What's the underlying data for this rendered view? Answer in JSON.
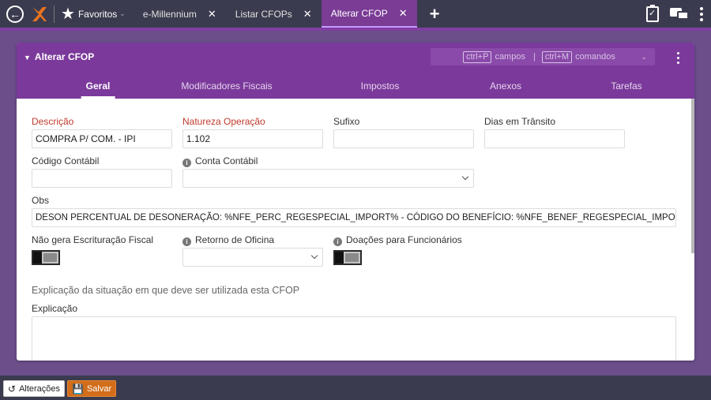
{
  "topbar": {
    "back_icon": "back-arrow-icon",
    "logo_icon": "brand-logo-icon",
    "favorites_label": "Favoritos",
    "tabs": [
      {
        "label": "e-Millennium"
      },
      {
        "label": "Listar CFOPs"
      },
      {
        "label": "Alterar CFOP"
      }
    ],
    "active_tab_color": "#7a3c95"
  },
  "panel": {
    "title": "Alterar CFOP",
    "cmd": {
      "campos_key": "ctrl+P",
      "campos_label": "campos",
      "separator": "|",
      "comandos_key": "ctrl+M",
      "comandos_label": "comandos"
    },
    "tabs": [
      {
        "label": "Geral"
      },
      {
        "label": "Modificadores Fiscais"
      },
      {
        "label": "Impostos"
      },
      {
        "label": "Anexos"
      },
      {
        "label": "Tarefas"
      }
    ],
    "header_color": "#7b3a9b"
  },
  "form": {
    "descricao": {
      "label": "Descrição",
      "value": "COMPRA P/ COM. - IPI"
    },
    "natureza": {
      "label": "Natureza Operação",
      "value": "1.102"
    },
    "sufixo": {
      "label": "Sufixo",
      "value": ""
    },
    "dias": {
      "label": "Dias em Trânsito",
      "value": ""
    },
    "codigo_contabil": {
      "label": "Código Contábil",
      "value": ""
    },
    "conta_contabil": {
      "label": "Conta Contábil",
      "value": ""
    },
    "obs": {
      "label": "Obs",
      "value": "DESON PERCENTUAL DE DESONERAÇÃO: %NFE_PERC_REGESPECIAL_IMPORT% - CÓDIGO DO BENEFÍCIO: %NFE_BENEF_REGESPECIAL_IMPORT%"
    },
    "nao_gera": {
      "label": "Não gera Escrituração Fiscal",
      "checked": false
    },
    "retorno": {
      "label": "Retorno de Oficina",
      "value": ""
    },
    "doacoes": {
      "label": "Doações para Funcionários",
      "checked": false
    },
    "section_title": "Explicação da situação em que deve ser utilizada esta CFOP",
    "explicacao": {
      "label": "Explicação",
      "value": ""
    },
    "required_color": "#c0392b"
  },
  "bottom": {
    "alteracoes_label": "Alterações",
    "salvar_label": "Salvar",
    "save_color": "#d26d1a"
  }
}
